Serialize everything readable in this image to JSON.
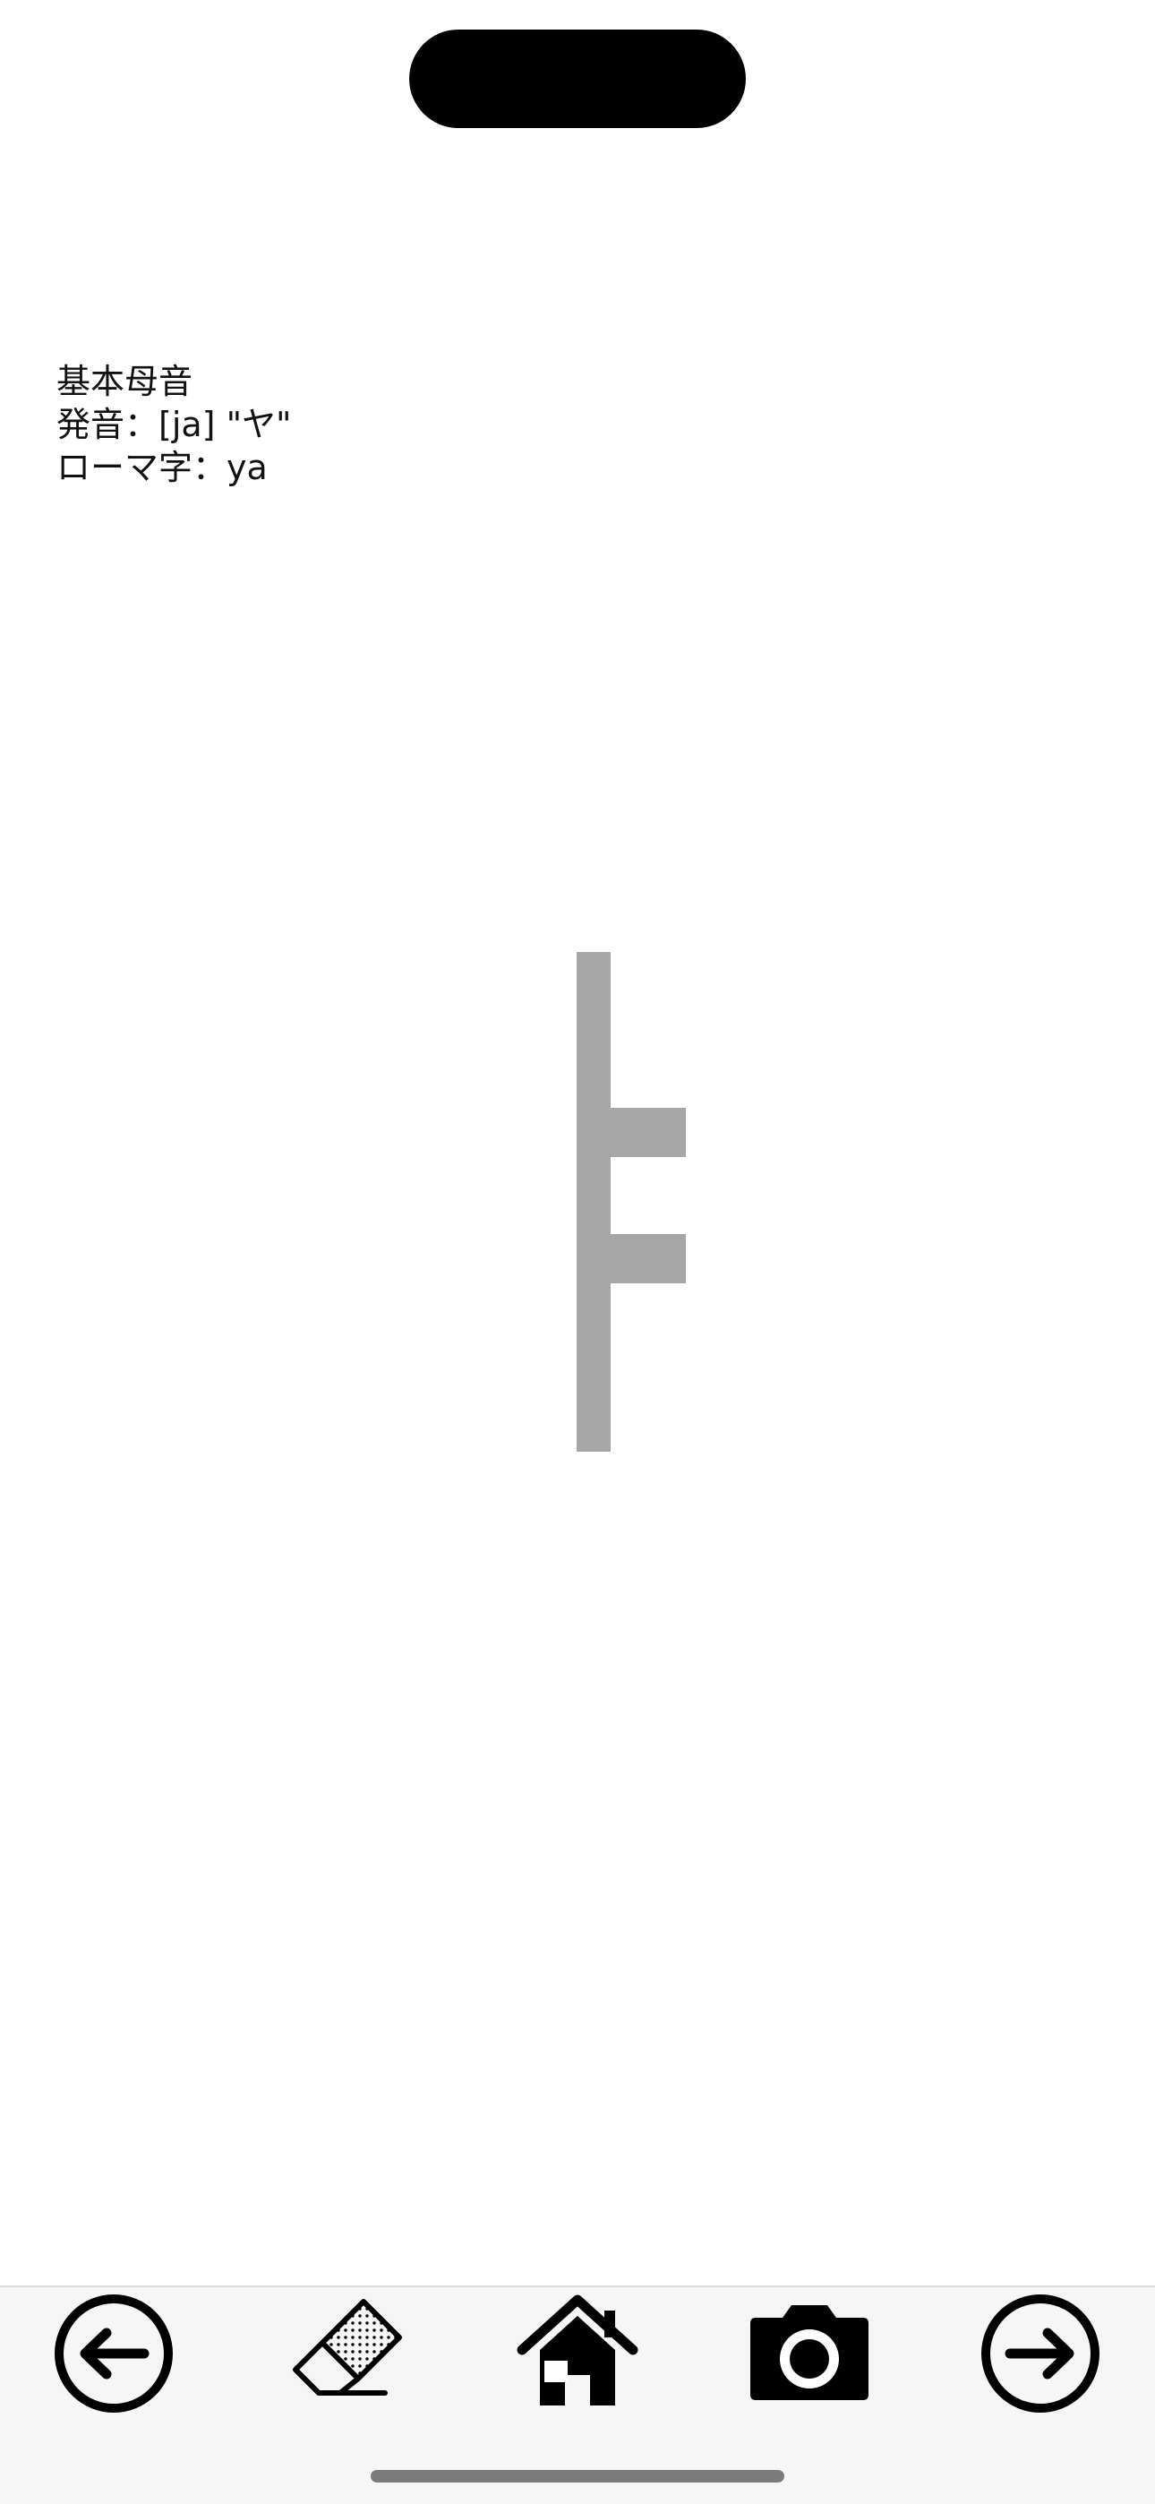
{
  "lesson": {
    "category": "基本母音",
    "pronunciation": "発音：[ja] \"ヤ\"",
    "romanization": "ローマ字：ya"
  },
  "character": {
    "hangul": "ㅑ",
    "stroke_color": "#a6a6a6"
  },
  "toolbar": {
    "items": [
      {
        "name": "previous",
        "icon": "arrow-left-circle-icon"
      },
      {
        "name": "eraser",
        "icon": "eraser-icon"
      },
      {
        "name": "home",
        "icon": "house-icon"
      },
      {
        "name": "camera",
        "icon": "camera-icon"
      },
      {
        "name": "next",
        "icon": "arrow-right-circle-icon"
      }
    ]
  },
  "colors": {
    "background": "#ffffff",
    "toolbar_background": "#f6f6f6",
    "icon": "#000000"
  }
}
